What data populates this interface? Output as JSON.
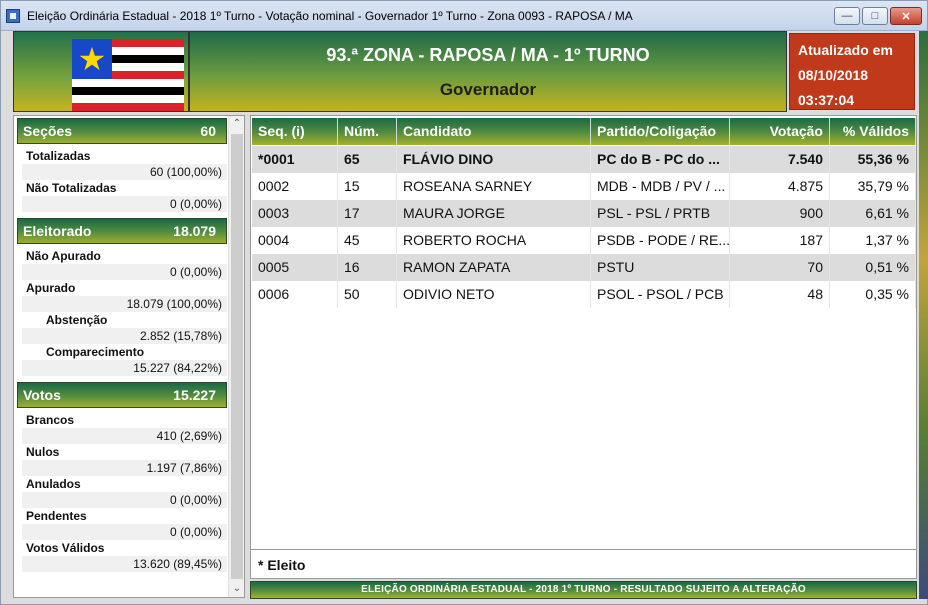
{
  "window": {
    "title": "Eleição Ordinária Estadual - 2018 1º Turno - Votação nominal - Governador 1º Turno - Zona 0093 - RAPOSA / MA",
    "minimize": "—",
    "maximize": "□",
    "close": "✕"
  },
  "header": {
    "title": "93.ª ZONA - RAPOSA / MA - 1º TURNO",
    "subtitle": "Governador",
    "updated_label": "Atualizado em",
    "updated_date": "08/10/2018",
    "updated_time": "03:37:04",
    "flag_star": "★"
  },
  "secoes": {
    "label": "Seções",
    "value": "60",
    "totalizadas_label": "Totalizadas",
    "totalizadas_value": "60 (100,00%)",
    "nao_totalizadas_label": "Não Totalizadas",
    "nao_totalizadas_value": "0 (0,00%)"
  },
  "eleitorado": {
    "label": "Eleitorado",
    "value": "18.079",
    "nao_apurado_label": "Não Apurado",
    "nao_apurado_value": "0 (0,00%)",
    "apurado_label": "Apurado",
    "apurado_value": "18.079 (100,00%)",
    "abstencao_label": "Abstenção",
    "abstencao_value": "2.852 (15,78%)",
    "comparecimento_label": "Comparecimento",
    "comparecimento_value": "15.227 (84,22%)"
  },
  "votos": {
    "label": "Votos",
    "value": "15.227",
    "brancos_label": "Brancos",
    "brancos_value": "410 (2,69%)",
    "nulos_label": "Nulos",
    "nulos_value": "1.197 (7,86%)",
    "anulados_label": "Anulados",
    "anulados_value": "0 (0,00%)",
    "pendentes_label": "Pendentes",
    "pendentes_value": "0 (0,00%)",
    "validos_label": "Votos Válidos",
    "validos_value": "13.620 (89,45%)"
  },
  "scroll": {
    "up": "⌃",
    "down": "⌄"
  },
  "table": {
    "headers": {
      "seq": "Seq.  (i)",
      "num": "Núm.",
      "candidato": "Candidato",
      "partido": "Partido/Coligação",
      "votacao": "Votação",
      "validos": "% Válidos"
    },
    "rows": [
      {
        "seq": "*0001",
        "num": "65",
        "candidato": "FLÁVIO DINO",
        "partido": "PC do B - PC do ...",
        "votacao": "7.540",
        "validos": "55,36 %"
      },
      {
        "seq": "0002",
        "num": "15",
        "candidato": "ROSEANA SARNEY",
        "partido": "MDB - MDB / PV / ...",
        "votacao": "4.875",
        "validos": "35,79 %"
      },
      {
        "seq": "0003",
        "num": "17",
        "candidato": "MAURA JORGE",
        "partido": "PSL - PSL / PRTB",
        "votacao": "900",
        "validos": "6,61 %"
      },
      {
        "seq": "0004",
        "num": "45",
        "candidato": "ROBERTO ROCHA",
        "partido": "PSDB - PODE / RE...",
        "votacao": "187",
        "validos": "1,37 %"
      },
      {
        "seq": "0005",
        "num": "16",
        "candidato": "RAMON ZAPATA",
        "partido": "PSTU",
        "votacao": "70",
        "validos": "0,51 %"
      },
      {
        "seq": "0006",
        "num": "50",
        "candidato": "ODIVIO NETO",
        "partido": "PSOL - PSOL / PCB",
        "votacao": "48",
        "validos": "0,35 %"
      }
    ]
  },
  "legend": "* Eleito",
  "footer": "ELEIÇÃO ORDINÁRIA ESTADUAL - 2018 1º TURNO - RESULTADO SUJEITO A ALTERAÇÃO"
}
